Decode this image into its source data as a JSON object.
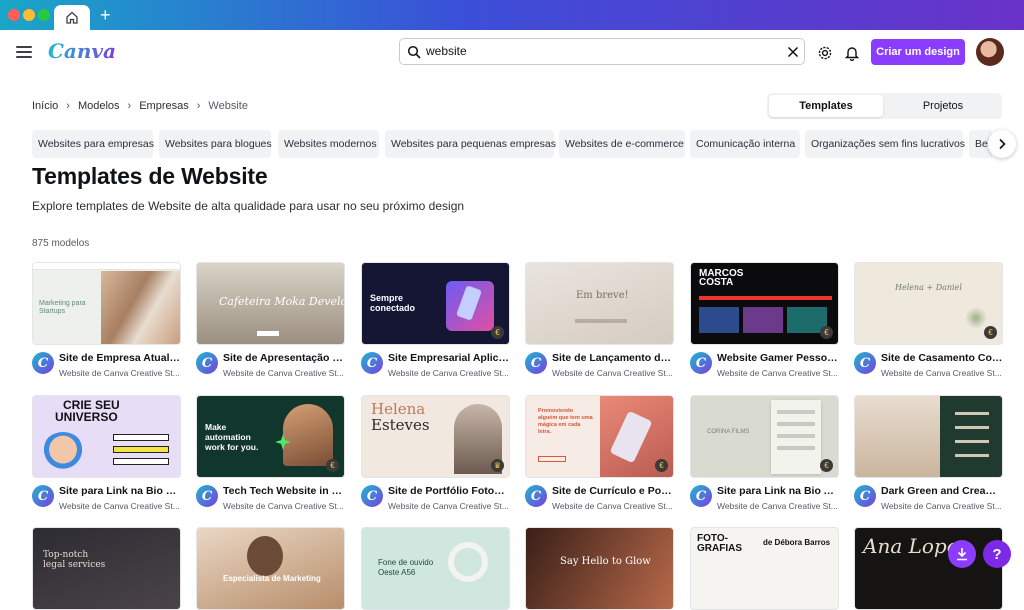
{
  "topbar": {
    "logo": "Canva",
    "search": {
      "value": "website",
      "placeholder": "website"
    },
    "cta_label": "Criar um design"
  },
  "breadcrumb": [
    "Início",
    "Modelos",
    "Empresas",
    "Website"
  ],
  "toggle": {
    "templates": "Templates",
    "projects": "Projetos"
  },
  "chips": [
    "Websites para empresas",
    "Websites para blogues",
    "Websites modernos",
    "Websites para pequenas empresas",
    "Websites de e-commerce",
    "Comunicação interna",
    "Organizações sem fins lucrativos",
    "Bel"
  ],
  "heading": "Templates de Website",
  "subtitle": "Explore templates de Website de alta qualidade para usar no seu próximo design",
  "count": "875 modelos",
  "cards": [
    {
      "title": "Site de Empresa Atual e ...",
      "author": "Website de Canva Creative St..."
    },
    {
      "title": "Site de Apresentação de ...",
      "author": "Website de Canva Creative St..."
    },
    {
      "title": "Site Empresarial Aplicati...",
      "author": "Website de Canva Creative St..."
    },
    {
      "title": "Site de Lançamento de ...",
      "author": "Website de Canva Creative St..."
    },
    {
      "title": "Website Gamer Pessoal ...",
      "author": "Website de Canva Creative St..."
    },
    {
      "title": "Site de Casamento Conv...",
      "author": "Website de Canva Creative St..."
    },
    {
      "title": "Site para Link na Bio par...",
      "author": "Website de Canva Creative St..."
    },
    {
      "title": "Tech Tech Website in Da...",
      "author": "Website de Canva Creative St..."
    },
    {
      "title": "Site de Portfólio Fotogra...",
      "author": "Website de Canva Creative St..."
    },
    {
      "title": "Site de Currículo e Portf...",
      "author": "Website de Canva Creative St..."
    },
    {
      "title": "Site para Link na Bio Ali...",
      "author": "Website de Canva Creative St..."
    },
    {
      "title": "Dark Green and Cream S...",
      "author": "Website de Canva Creative St..."
    }
  ],
  "thumb_text": {
    "t1": "Marketing para Startups",
    "t2": "Cafeteira Moka Develo",
    "t3": "Sempre conectado",
    "t4": "Em breve!",
    "t5a": "MARCOS",
    "t5b": "COSTA",
    "t6": "Helena + Daniel",
    "t7a": "CRIE SEU",
    "t7b": "UNIVERSO",
    "t8": "Make automation work for you.",
    "t9a": "Helena",
    "t9b": "Esteves",
    "t10": "Promoviendo alguém que tem uma mágica em cada letra.",
    "t11": "CORINA FILMS",
    "t13": "Top-notch legal services",
    "t14": "Especialista de Marketing",
    "t15": "Fone de ouvido Oeste A56",
    "t16": "Say Hello to Glow",
    "t17a": "FOTO-GRAFIAS",
    "t17b": "de Débora Barros",
    "t18": "Ana Lopes"
  },
  "colors": {
    "accent": "#8b3dff",
    "help": "#7d2ae8"
  }
}
